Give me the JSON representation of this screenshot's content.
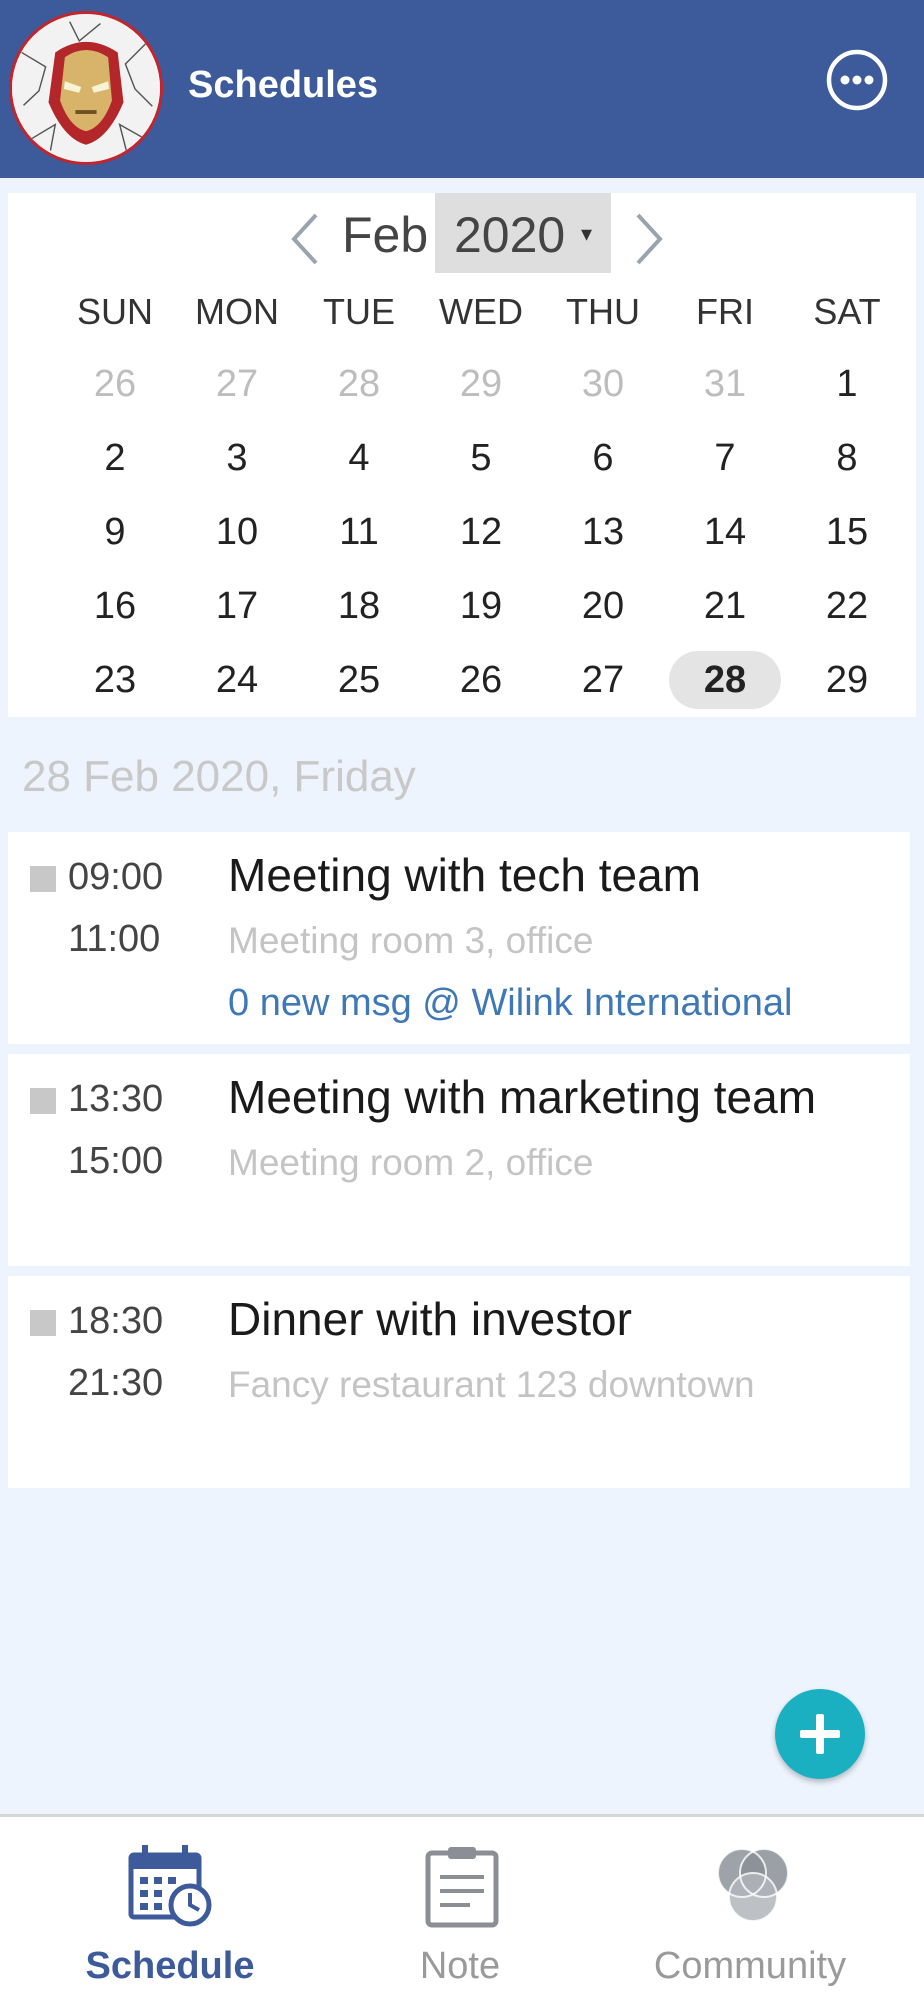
{
  "header": {
    "title": "Schedules",
    "avatar_icon": "iron-man-avatar",
    "more_icon": "more-options-icon"
  },
  "calendar": {
    "month": "Feb",
    "year": "2020",
    "year_caret": "▾",
    "weekdays": [
      "SUN",
      "MON",
      "TUE",
      "WED",
      "THU",
      "FRI",
      "SAT"
    ],
    "weeks": [
      [
        "26",
        "27",
        "28",
        "29",
        "30",
        "31",
        "1"
      ],
      [
        "2",
        "3",
        "4",
        "5",
        "6",
        "7",
        "8"
      ],
      [
        "9",
        "10",
        "11",
        "12",
        "13",
        "14",
        "15"
      ],
      [
        "16",
        "17",
        "18",
        "19",
        "20",
        "21",
        "22"
      ],
      [
        "23",
        "24",
        "25",
        "26",
        "27",
        "28",
        "29"
      ]
    ],
    "selected_day": "28"
  },
  "date_heading": "28 Feb 2020, Friday",
  "events": [
    {
      "start": "09:00",
      "end": "11:00",
      "title": "Meeting with tech team",
      "location": "Meeting room 3, office",
      "message": "0 new msg @ Wilink International"
    },
    {
      "start": "13:30",
      "end": "15:00",
      "title": "Meeting with marketing team",
      "location": "Meeting room 2, office"
    },
    {
      "start": "18:30",
      "end": "21:30",
      "title": "Dinner with investor",
      "location": "Fancy restaurant 123 downtown"
    }
  ],
  "bottom_nav": {
    "items": [
      {
        "label": "Schedule",
        "icon": "calendar-clock-icon",
        "active": true
      },
      {
        "label": "Note",
        "icon": "clipboard-note-icon",
        "active": false
      },
      {
        "label": "Community",
        "icon": "community-circles-icon",
        "active": false
      }
    ]
  },
  "colors": {
    "header_bg": "#3d5a9b",
    "page_bg": "#edf4fd",
    "fab": "#1ab0c1",
    "link": "#3f78b6",
    "active_nav": "#3d5a9b"
  }
}
